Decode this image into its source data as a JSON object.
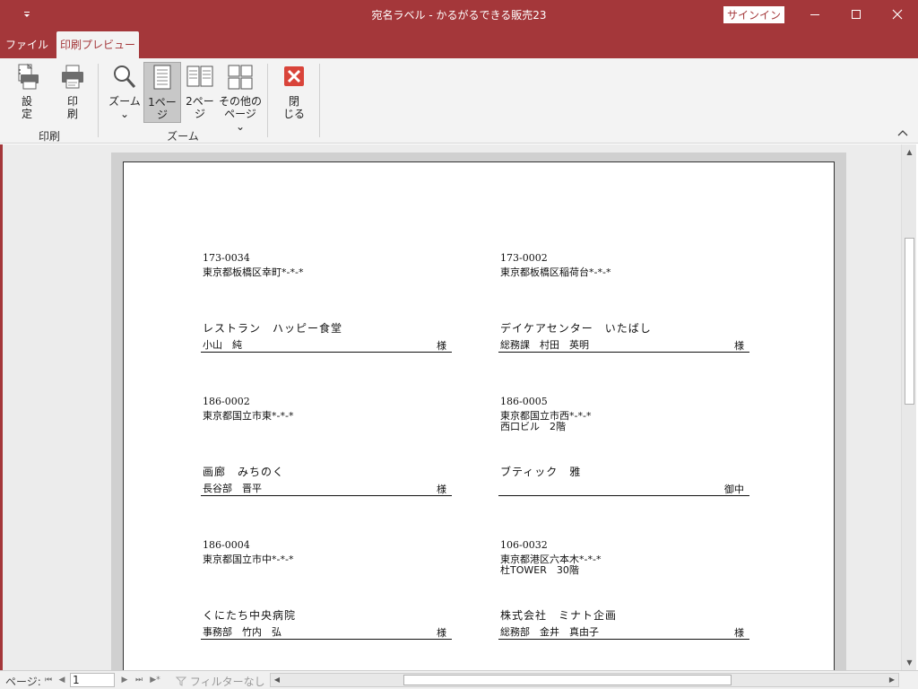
{
  "window": {
    "qat_icon": "quick-access-dropdown",
    "title": "宛名ラベル  -  かるがるできる販売23",
    "signin": "サインイン",
    "minimize": "—",
    "maximize": "☐",
    "close": "✕"
  },
  "tabs": {
    "file": "ファイル",
    "print_preview": "印刷プレビュー"
  },
  "ribbon": {
    "setup_label1": "設",
    "setup_label2": "定",
    "print_label1": "印",
    "print_label2": "刷",
    "zoom_label": "ズーム",
    "zoom_arrow": "⌄",
    "one_page_label1": "1ペー",
    "one_page_label2": "ジ",
    "two_page_label1": "2ペー",
    "two_page_label2": "ジ",
    "more_pages_label1": "その他の",
    "more_pages_label2": "ページ ⌄",
    "close_label1": "閉",
    "close_label2": "じる",
    "group_print": "印刷",
    "group_zoom": "ズーム"
  },
  "labels": [
    {
      "zip": "173-0034",
      "address1": "東京都板橋区幸町*-*-*",
      "address2": "",
      "company": "レストラン　ハッピー食堂",
      "person": "小山　純",
      "honorific": "様"
    },
    {
      "zip": "173-0002",
      "address1": "東京都板橋区稲荷台*-*-*",
      "address2": "",
      "company": "デイケアセンター　いたばし",
      "person": "総務課　村田　英明",
      "honorific": "様"
    },
    {
      "zip": "186-0002",
      "address1": "東京都国立市東*-*-*",
      "address2": "",
      "company": "画廊　みちのく",
      "person": "長谷部　晋平",
      "honorific": "様"
    },
    {
      "zip": "186-0005",
      "address1": "東京都国立市西*-*-*",
      "address2": "西口ビル　2階",
      "company": "ブティック　雅",
      "person": "",
      "honorific": "御中"
    },
    {
      "zip": "186-0004",
      "address1": "東京都国立市中*-*-*",
      "address2": "",
      "company": "くにたち中央病院",
      "person": "事務部　竹内　弘",
      "honorific": "様"
    },
    {
      "zip": "106-0032",
      "address1": "東京都港区六本木*-*-*",
      "address2": "杜TOWER　30階",
      "company": "株式会社　ミナト企画",
      "person": "総務部　金井　真由子",
      "honorific": "様"
    }
  ],
  "navigation": {
    "page_label": "ページ:",
    "first": "⏮",
    "prev": "◀",
    "current_page": "1",
    "next": "▶",
    "last": "⏭",
    "new": "▶*",
    "filter": "フィルターなし"
  },
  "colors": {
    "accent": "#a4373a",
    "ribbon_bg": "#f3f3f3",
    "close_icon": "#d9443a"
  }
}
